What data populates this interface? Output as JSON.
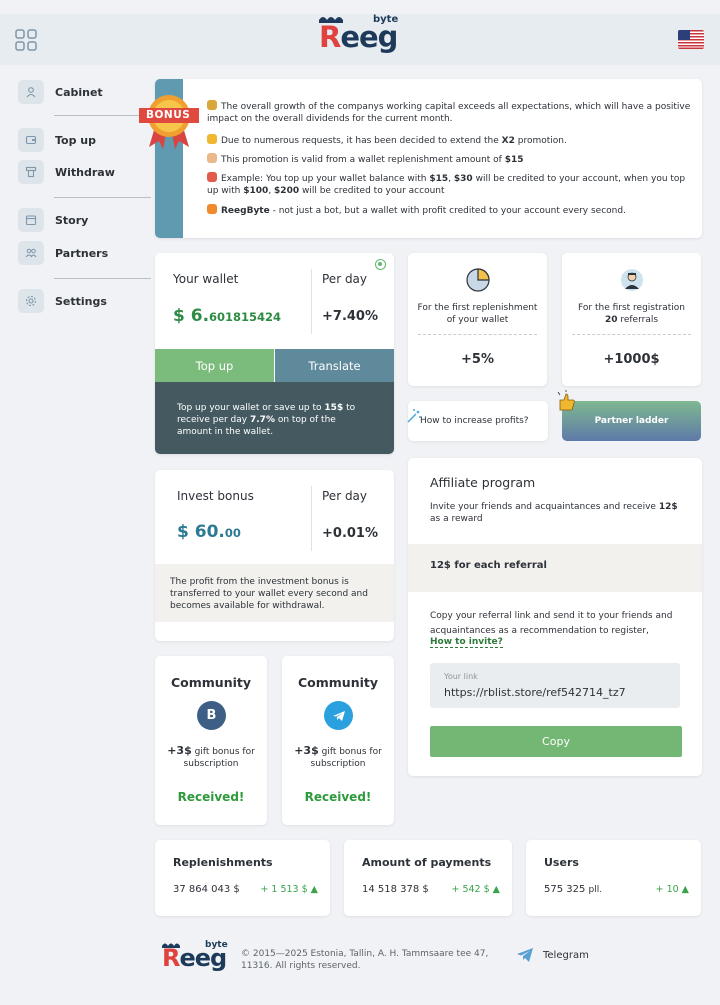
{
  "header": {
    "logo_small": "byte",
    "logo_main": "Reeg",
    "grid_icon": "grid-icon",
    "flag": "us-flag-icon"
  },
  "sidebar": {
    "items": [
      {
        "label": "Cabinet",
        "icon": "user-icon"
      },
      {
        "label": "Top up",
        "icon": "wallet-icon"
      },
      {
        "label": "Withdraw",
        "icon": "withdraw-icon"
      },
      {
        "label": "Story",
        "icon": "calendar-icon"
      },
      {
        "label": "Partners",
        "icon": "users-icon"
      },
      {
        "label": "Settings",
        "icon": "gear-icon"
      }
    ]
  },
  "bonus": {
    "badge": "BONUS",
    "lines": [
      "The overall growth of the companys working capital exceeds all expectations, which will have a positive impact on the overall dividends for the current month.",
      "Due to numerous requests, it has been decided to extend the",
      "X2",
      "promotion.",
      "This promotion is valid from a wallet replenishment amount of",
      "$15",
      "Example: You top up your wallet balance with",
      "$15",
      "$30",
      "will be credited to your account, when you top up with",
      "$100",
      "$200",
      "will be credited to your account",
      "ReegByte",
      "- not just a bot, but a wallet with profit credited to your account every second."
    ]
  },
  "wallet": {
    "label": "Your wallet",
    "per_day_label": "Per day",
    "amount_main": "$ 6.",
    "amount_frac": "601815424",
    "per_day": "+7.40%",
    "topup": "Top up",
    "translate": "Translate",
    "note_1": "Top up your wallet or save up to",
    "note_2": "15$",
    "note_3": "to receive per day",
    "note_4": "7.7%",
    "note_5": "on top of the amount in the wallet."
  },
  "invest": {
    "label": "Invest bonus",
    "per_day_label": "Per day",
    "amount_main": "$ 60.",
    "amount_frac": "00",
    "per_day": "+0.01%",
    "note": "The profit from the investment bonus is transferred to your wallet every second and becomes available for withdrawal."
  },
  "community": [
    {
      "title": "Community",
      "icon": "vk-icon",
      "glyph": "B",
      "bonus": "+3$",
      "text": "gift bonus for subscription",
      "status": "Received!"
    },
    {
      "title": "Community",
      "icon": "telegram-icon",
      "glyph": "",
      "bonus": "+3$",
      "text": "gift bonus for subscription",
      "status": "Received!"
    }
  ],
  "first_cards": [
    {
      "icon": "pie-chart-icon",
      "text_1": "For the first replenishment",
      "text_2": "of your wallet",
      "value": "+5%"
    },
    {
      "icon": "person-avatar-icon",
      "text_1": "For the first registration",
      "text_2b": "20",
      "text_2": "referrals",
      "value": "+1000$"
    }
  ],
  "how_profit": "How to increase profits?",
  "partner_ladder": "Partner ladder",
  "affiliate": {
    "title": "Affiliate program",
    "sub_1": "Invite your friends and acquaintances and receive",
    "sub_2": "12$",
    "sub_3": "as a reward",
    "band": "12$ for each referral",
    "copy_text": "Copy your referral link and send it to your friends and acquaintances as a recommendation to register,",
    "how_invite": "How to invite?",
    "link_placeholder": "Your link",
    "link_value": "https://rblist.store/ref542714_tz7",
    "copy": "Copy"
  },
  "stats": [
    {
      "label": "Replenishments",
      "value": "37 864 043 $",
      "unit": "",
      "delta": "+ 1 513 $ ▲"
    },
    {
      "label": "Amount of payments",
      "value": "14 518 378 $",
      "unit": "",
      "delta": "+ 542 $ ▲"
    },
    {
      "label": "Users",
      "value": "575 325",
      "unit": "pll.",
      "delta": "+ 10 ▲"
    }
  ],
  "footer": {
    "text": "© 2015—2025 Estonia, Tallin, A. H. Tammsaare tee 47, 11316. All rights reserved.",
    "telegram": "Telegram"
  },
  "colors": {
    "accent_green": "#74b775",
    "accent_teal": "#5f8a9c",
    "dark_panel": "#455961",
    "logo_red": "#e0433f",
    "logo_navy": "#1e3a5a"
  }
}
